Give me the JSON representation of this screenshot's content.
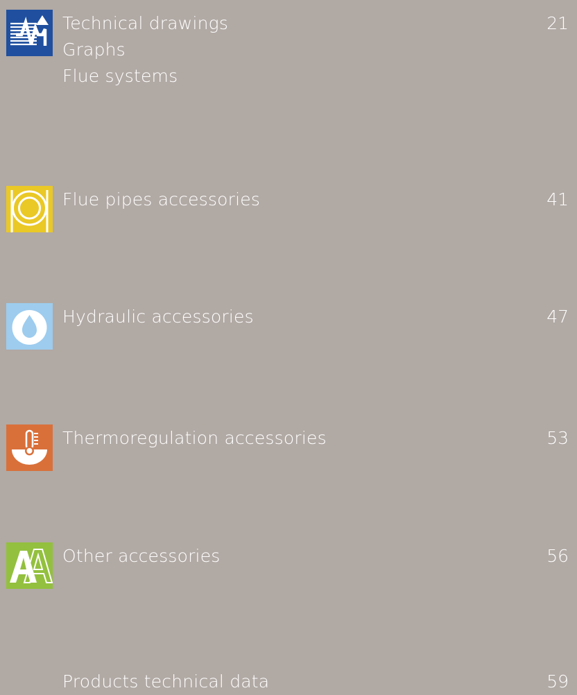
{
  "entries": [
    {
      "icon": "technical-drawings-icon",
      "color": "#1f4f9e",
      "titles": [
        "Technical drawings",
        "Graphs",
        "Flue systems"
      ],
      "page": "21"
    },
    {
      "icon": "flue-pipe-icon",
      "color": "#eac826",
      "titles": [
        "Flue pipes accessories"
      ],
      "page": "41"
    },
    {
      "icon": "water-drop-icon",
      "color": "#9dccee",
      "titles": [
        "Hydraulic accessories"
      ],
      "page": "47"
    },
    {
      "icon": "thermometer-icon",
      "color": "#d9703a",
      "titles": [
        "Thermoregulation accessories"
      ],
      "page": "53"
    },
    {
      "icon": "letter-a-icon",
      "color": "#93c03e",
      "titles": [
        "Other accessories"
      ],
      "page": "56"
    },
    {
      "icon": "",
      "color": "",
      "titles": [
        "Products technical data"
      ],
      "page": "59"
    }
  ]
}
